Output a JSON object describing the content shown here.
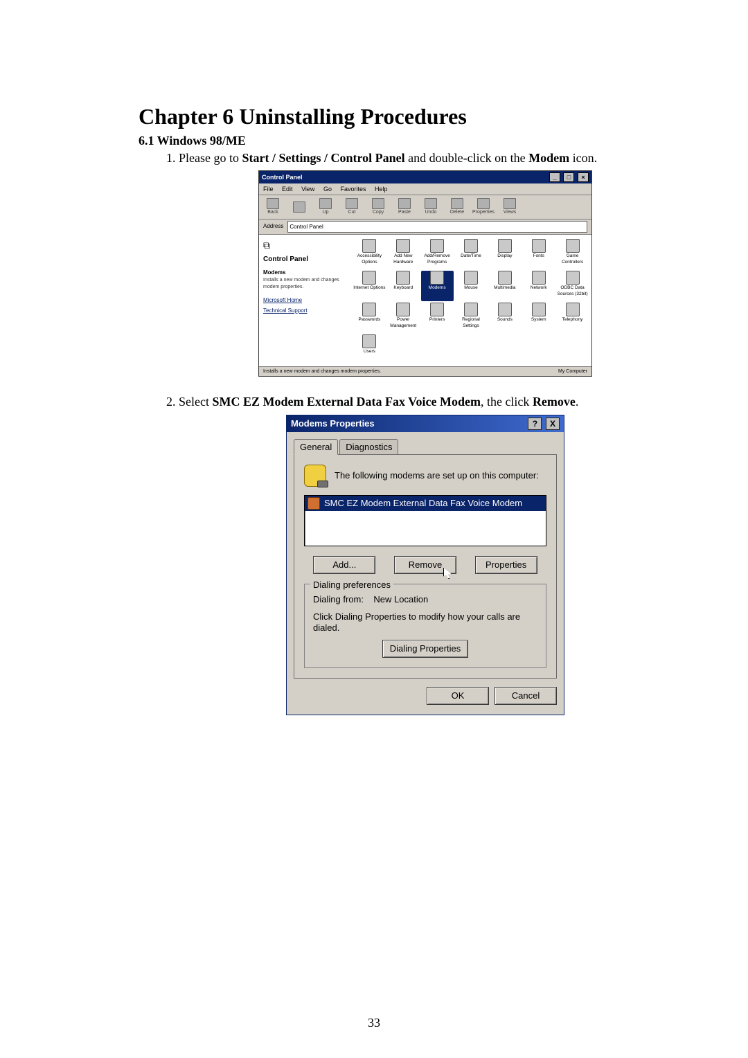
{
  "doc": {
    "chapter_title": "Chapter 6 Uninstalling Procedures",
    "section_heading": "6.1 Windows 98/ME",
    "step1_prefix": "Please go to ",
    "step1_bold": "Start / Settings / Control Panel",
    "step1_mid": " and double-click on the ",
    "step1_bold2": "Modem",
    "step1_suffix": " icon.",
    "step2_prefix": "Select ",
    "step2_bold": "SMC EZ Modem External Data Fax Voice Modem",
    "step2_mid": ", the click ",
    "step2_bold2": "Remove",
    "step2_suffix": ".",
    "page_number": "33"
  },
  "cp": {
    "title": "Control Panel",
    "menus": [
      "File",
      "Edit",
      "View",
      "Go",
      "Favorites",
      "Help"
    ],
    "tools": [
      "Back",
      "",
      "Up",
      "Cut",
      "Copy",
      "Paste",
      "Undo",
      "Delete",
      "Properties",
      "Views",
      ""
    ],
    "addr_label": "Address",
    "addr_value": "Control Panel",
    "side": {
      "heading": "Control Panel",
      "sub": "Modems",
      "desc": "Installs a new modem and changes modem properties.",
      "links": [
        "Microsoft Home",
        "Technical Support"
      ]
    },
    "items": [
      "Accessibility Options",
      "Add New Hardware",
      "Add/Remove Programs",
      "Date/Time",
      "Display",
      "Fonts",
      "Game Controllers",
      "Internet Options",
      "Keyboard",
      "Modems",
      "Mouse",
      "Multimedia",
      "Network",
      "ODBC Data Sources (32bit)",
      "Passwords",
      "Power Management",
      "Printers",
      "Regional Settings",
      "Sounds",
      "System",
      "Telephony",
      "Users"
    ],
    "status_left": "Installs a new modem and changes modem properties.",
    "status_right": "My Computer"
  },
  "md": {
    "title": "Modems Properties",
    "help_btn": "?",
    "close_btn": "X",
    "tab_general": "General",
    "tab_diag": "Diagnostics",
    "intro": "The following modems are set up on this computer:",
    "selected_item": "SMC EZ Modem External Data Fax Voice Modem",
    "btn_add": "Add...",
    "btn_remove": "Remove",
    "btn_props": "Properties",
    "group_label": "Dialing preferences",
    "dial_from_label": "Dialing from:",
    "dial_from_value": "New Location",
    "dial_hint": "Click Dialing Properties to modify how your calls are dialed.",
    "btn_dialprops": "Dialing Properties",
    "btn_ok": "OK",
    "btn_cancel": "Cancel"
  }
}
